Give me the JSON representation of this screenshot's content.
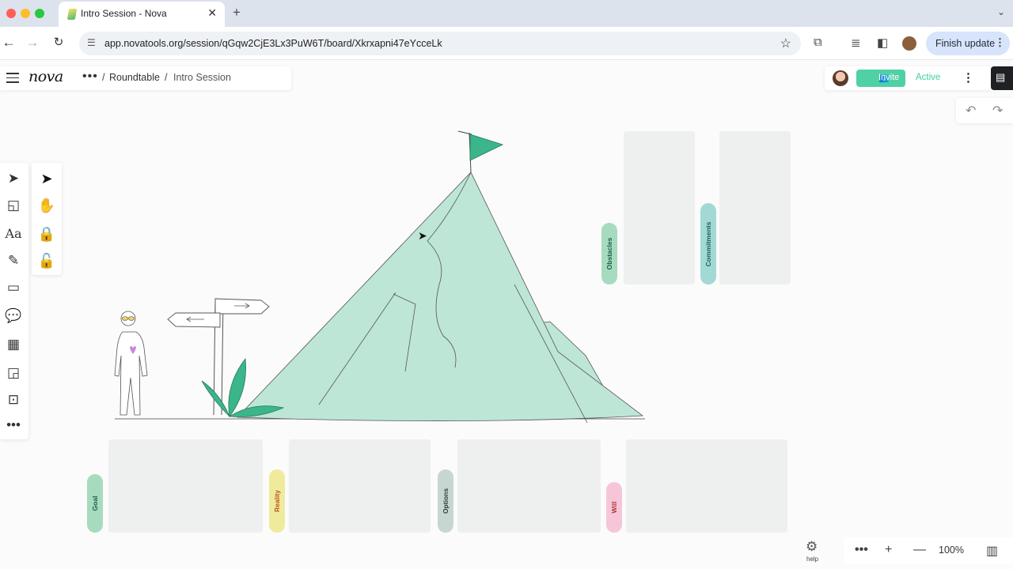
{
  "browser": {
    "tab_title": "Intro Session - Nova",
    "url": "app.novatools.org/session/qGqw2CjE3Lx3PuW6T/board/Xkrxapni47eYcceLk",
    "finish_update": "Finish update"
  },
  "app": {
    "logo": "nova",
    "breadcrumb": {
      "parent": "Roundtable",
      "current": "Intro Session"
    },
    "invite_label": "Invite",
    "status": "Active"
  },
  "frames": {
    "obstacles": "Obstacles",
    "commitments": "Commitments",
    "goal": "Goal",
    "reality": "Reality",
    "options": "Options",
    "will": "Will"
  },
  "footer": {
    "help_label": "help",
    "zoom": "100%"
  },
  "colors": {
    "accent": "#4fd1a5",
    "mountain": "#bde6d6",
    "flag": "#3bb58a",
    "goal_pill": "#a7dbbf",
    "reality_pill": "#f0ea9c",
    "options_pill": "#c8d6d0",
    "will_pill": "#f6c6d8",
    "obstacles_pill": "#a7dbbf",
    "commitments_pill": "#a3d9d5"
  }
}
